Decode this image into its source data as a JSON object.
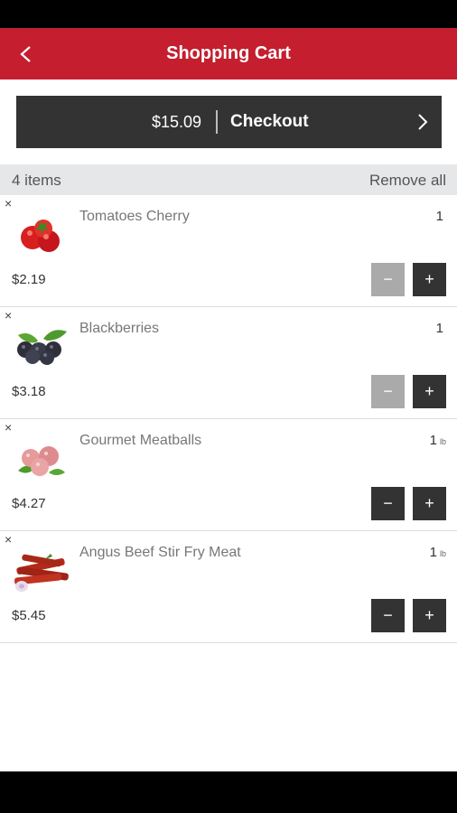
{
  "header": {
    "title": "Shopping Cart",
    "back_icon": "chevron-left-icon"
  },
  "checkout": {
    "total": "$15.09",
    "label": "Checkout",
    "arrow_icon": "chevron-right-icon"
  },
  "summary": {
    "count": "4 items",
    "remove_all": "Remove all"
  },
  "colors": {
    "brand_red": "#c41e2f",
    "dark": "#333333",
    "disabled": "#aaaaaa"
  },
  "items": [
    {
      "name": "Tomatoes Cherry",
      "qty": "1",
      "unit": "",
      "price": "$2.19",
      "minus_enabled": false,
      "remove": "×",
      "minus": "−",
      "plus": "+",
      "image": "cherry-tomatoes"
    },
    {
      "name": "Blackberries",
      "qty": "1",
      "unit": "",
      "price": "$3.18",
      "minus_enabled": false,
      "remove": "×",
      "minus": "−",
      "plus": "+",
      "image": "blackberries"
    },
    {
      "name": "Gourmet Meatballs",
      "qty": "1",
      "unit": "lb",
      "price": "$4.27",
      "minus_enabled": true,
      "remove": "×",
      "minus": "−",
      "plus": "+",
      "image": "meatballs"
    },
    {
      "name": "Angus Beef Stir Fry Meat",
      "qty": "1",
      "unit": "lb",
      "price": "$5.45",
      "minus_enabled": true,
      "remove": "×",
      "minus": "−",
      "plus": "+",
      "image": "beef-strips"
    }
  ]
}
